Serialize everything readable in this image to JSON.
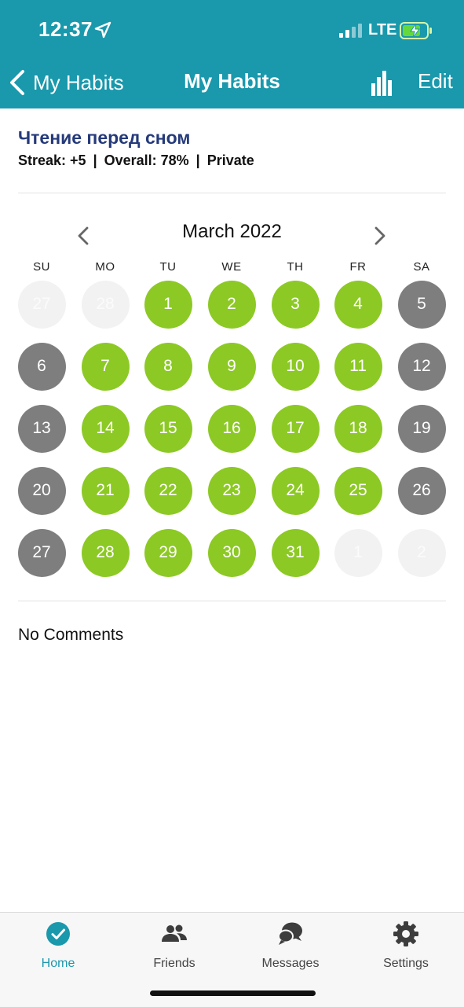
{
  "status_bar": {
    "time": "12:37",
    "network": "LTE"
  },
  "nav": {
    "back_label": "My Habits",
    "title": "My Habits",
    "edit_label": "Edit"
  },
  "habit": {
    "title": "Чтение перед сном",
    "streak": "Streak: +5",
    "overall": "Overall: 78%",
    "privacy": "Private",
    "separator": "|"
  },
  "calendar": {
    "month_label": "March 2022",
    "weekdays": [
      "SU",
      "MO",
      "TU",
      "WE",
      "TH",
      "FR",
      "SA"
    ],
    "weeks": [
      [
        {
          "d": "27",
          "s": "faded"
        },
        {
          "d": "28",
          "s": "faded"
        },
        {
          "d": "1",
          "s": "green"
        },
        {
          "d": "2",
          "s": "green"
        },
        {
          "d": "3",
          "s": "green"
        },
        {
          "d": "4",
          "s": "green"
        },
        {
          "d": "5",
          "s": "gray"
        }
      ],
      [
        {
          "d": "6",
          "s": "gray"
        },
        {
          "d": "7",
          "s": "green"
        },
        {
          "d": "8",
          "s": "green"
        },
        {
          "d": "9",
          "s": "green"
        },
        {
          "d": "10",
          "s": "green"
        },
        {
          "d": "11",
          "s": "green"
        },
        {
          "d": "12",
          "s": "gray"
        }
      ],
      [
        {
          "d": "13",
          "s": "gray"
        },
        {
          "d": "14",
          "s": "green"
        },
        {
          "d": "15",
          "s": "green"
        },
        {
          "d": "16",
          "s": "green"
        },
        {
          "d": "17",
          "s": "green"
        },
        {
          "d": "18",
          "s": "green"
        },
        {
          "d": "19",
          "s": "gray"
        }
      ],
      [
        {
          "d": "20",
          "s": "gray"
        },
        {
          "d": "21",
          "s": "green"
        },
        {
          "d": "22",
          "s": "green"
        },
        {
          "d": "23",
          "s": "green"
        },
        {
          "d": "24",
          "s": "green"
        },
        {
          "d": "25",
          "s": "green"
        },
        {
          "d": "26",
          "s": "gray"
        }
      ],
      [
        {
          "d": "27",
          "s": "gray"
        },
        {
          "d": "28",
          "s": "green"
        },
        {
          "d": "29",
          "s": "green"
        },
        {
          "d": "30",
          "s": "green"
        },
        {
          "d": "31",
          "s": "green"
        },
        {
          "d": "1",
          "s": "faded"
        },
        {
          "d": "2",
          "s": "faded"
        }
      ]
    ]
  },
  "comments": {
    "empty_label": "No Comments"
  },
  "tabbar": {
    "tabs": [
      {
        "label": "Home",
        "icon": "check-circle-icon",
        "active": true
      },
      {
        "label": "Friends",
        "icon": "friends-icon",
        "active": false
      },
      {
        "label": "Messages",
        "icon": "messages-icon",
        "active": false
      },
      {
        "label": "Settings",
        "icon": "gear-icon",
        "active": false
      }
    ]
  },
  "colors": {
    "header": "#1a98ac",
    "done": "#8cc924",
    "missed": "#7e7e7e",
    "outside_month": "#f2f2f2",
    "habit_title": "#253a7a",
    "active_tab": "#1a98ac"
  }
}
